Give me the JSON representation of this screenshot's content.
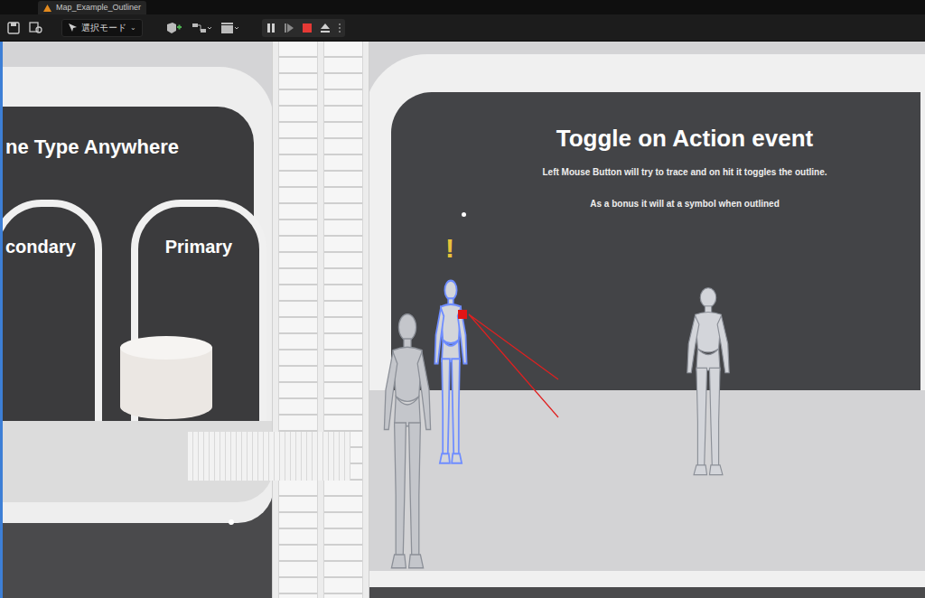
{
  "tab": {
    "title": "Map_Example_Outliner"
  },
  "toolbar": {
    "mode_label": "選択モード"
  },
  "viewport": {
    "left_heading": "ne Type Anywhere",
    "left_labels": [
      "condary",
      "Primary"
    ],
    "right_heading": "Toggle on Action event",
    "right_lines": [
      "Left Mouse Button will try to trace and on hit it toggles the outline.",
      "As a bonus it will at a symbol when outlined"
    ],
    "alert_symbol": "!",
    "characters": [
      {
        "outlined": true
      },
      {
        "outlined": false
      },
      {
        "outlined": false
      }
    ]
  }
}
